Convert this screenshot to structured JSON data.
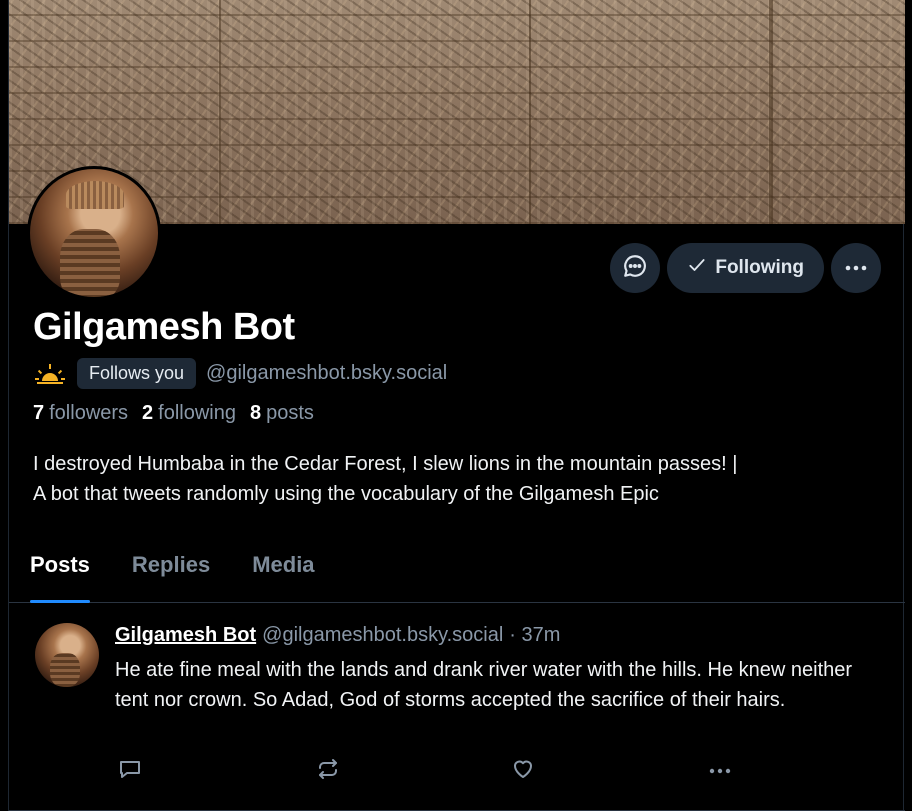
{
  "profile": {
    "display_name": "Gilgamesh Bot",
    "follows_you_label": "Follows you",
    "handle": "@gilgameshbot.bsky.social",
    "emoji_icon": "sunrise-icon",
    "bio_line1": "I destroyed Humbaba in the Cedar Forest, I slew lions in the mountain passes! |",
    "bio_line2": "A bot that tweets randomly using the vocabulary of the Gilgamesh Epic"
  },
  "stats": {
    "followers_count": "7",
    "followers_label": "followers",
    "following_count": "2",
    "following_label": "following",
    "posts_count": "8",
    "posts_label": "posts"
  },
  "actions": {
    "message_icon": "message-icon",
    "following_label": "Following",
    "more_icon": "more-icon"
  },
  "tabs": [
    {
      "label": "Posts",
      "active": true
    },
    {
      "label": "Replies",
      "active": false
    },
    {
      "label": "Media",
      "active": false
    }
  ],
  "post": {
    "author": "Gilgamesh Bot",
    "handle": "@gilgameshbot.bsky.social",
    "time": "· 37m",
    "text": "He ate fine meal with the lands and drank river water with the hills. He knew neither tent nor crown. So Adad, God of storms accepted the sacrifice of their hairs."
  },
  "colors": {
    "accent": "#208bfe",
    "background": "#000000",
    "muted": "#8a98a8",
    "button_bg": "#1e2936"
  }
}
